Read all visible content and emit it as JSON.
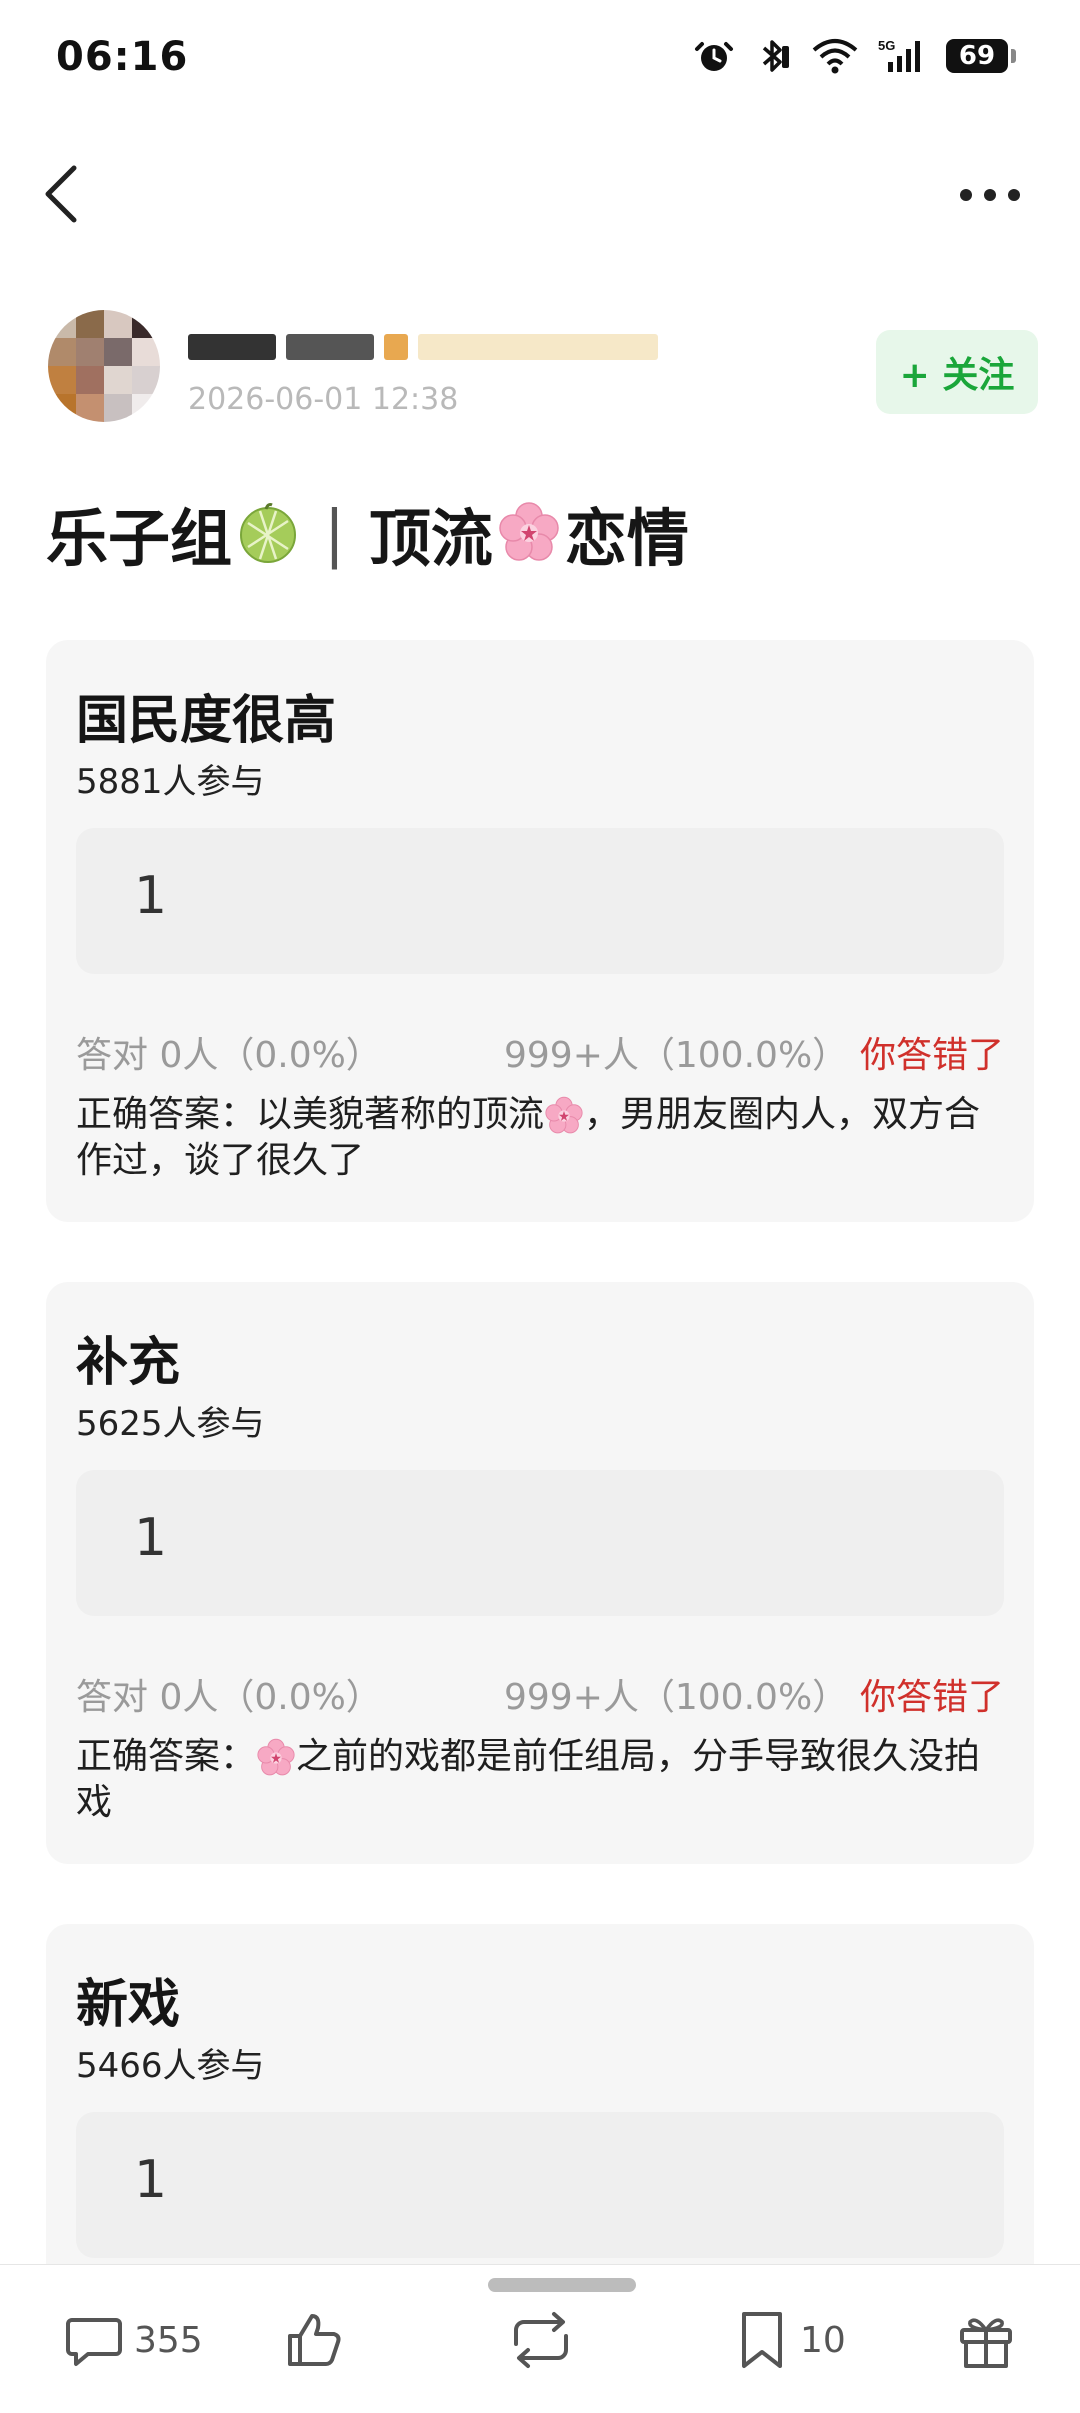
{
  "status_bar": {
    "time": "06:16",
    "battery": "69"
  },
  "author": {
    "date": "2026-06-01 12:38",
    "follow_label": "+ 关注"
  },
  "post": {
    "title_part1": "乐子组",
    "title_sep": "|",
    "title_part2": "顶流",
    "title_part3": "恋情"
  },
  "quizzes": [
    {
      "title": "国民度很高",
      "participants": "5881人参与",
      "option": "1",
      "correct_stat": "答对  0人（0.0%）",
      "chosen_stat": "999+人（100.0%）",
      "result": "你答错了",
      "answer_prefix": "正确答案：以美貌著称的顶流",
      "answer_suffix": "，男朋友圈内人，双方合作过，谈了很久了"
    },
    {
      "title": "补充",
      "participants": "5625人参与",
      "option": "1",
      "correct_stat": "答对  0人（0.0%）",
      "chosen_stat": "999+人（100.0%）",
      "result": "你答错了",
      "answer_prefix": "正确答案：",
      "answer_suffix": "之前的戏都是前任组局，分手导致很久没拍戏"
    },
    {
      "title": "新戏",
      "participants": "5466人参与",
      "option": "1"
    }
  ],
  "bottom_bar": {
    "comments": "355",
    "favorites": "10"
  },
  "icons": [
    "back-icon",
    "more-icon",
    "alarm-icon",
    "bluetooth-icon",
    "wifi-icon",
    "signal-icon",
    "melon-icon",
    "flower-icon",
    "comment-icon",
    "like-icon",
    "repost-icon",
    "bookmark-icon",
    "gift-icon"
  ],
  "colors": {
    "follow_bg": "#e7f7ea",
    "follow_text": "#1aa63a",
    "wrong": "#d0302b",
    "card_bg": "#f6f6f6"
  }
}
